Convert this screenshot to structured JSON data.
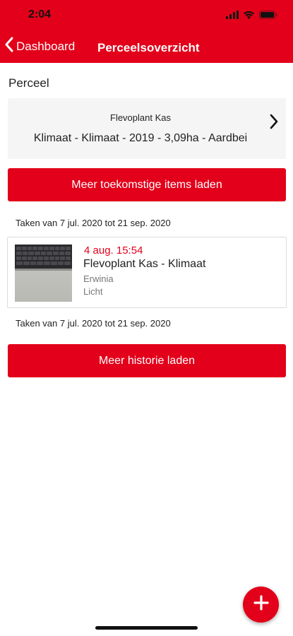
{
  "status_bar": {
    "time": "2:04"
  },
  "nav": {
    "back_label": "Dashboard",
    "title": "Perceelsoverzicht"
  },
  "perceel": {
    "section_label": "Perceel",
    "name": "Flevoplant Kas",
    "details": "Klimaat - Klimaat - 2019 - 3,09ha - Aardbei"
  },
  "buttons": {
    "load_future": "Meer toekomstige items laden",
    "load_history": "Meer historie laden"
  },
  "ranges": {
    "future": "Taken van 7 jul. 2020 tot 21 sep. 2020",
    "history": "Taken van 7 jul. 2020 tot 21 sep. 2020"
  },
  "tasks": [
    {
      "date": "4 aug. 15:54",
      "title": "Flevoplant Kas - Klimaat",
      "subtitle": "Erwinia",
      "detail": "Licht"
    }
  ],
  "colors": {
    "accent": "#e2001a"
  },
  "icons": {
    "back": "chevron-left-icon",
    "card_nav": "chevron-right-icon",
    "fab": "plus-icon"
  }
}
